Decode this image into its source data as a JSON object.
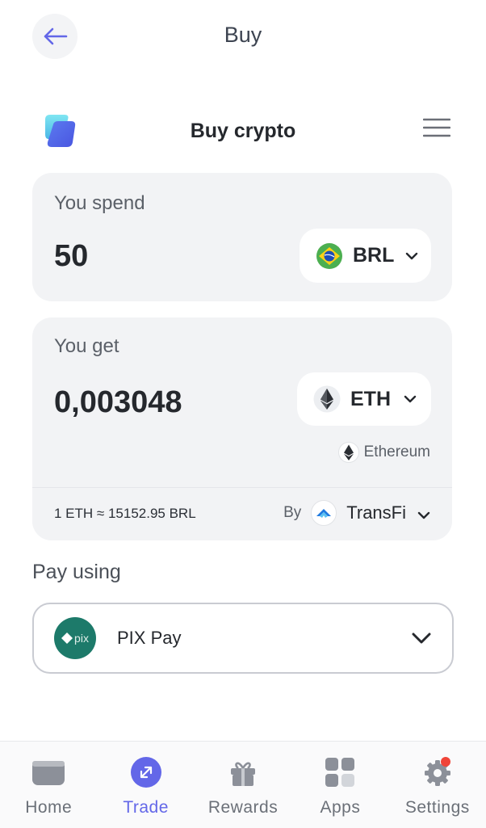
{
  "header": {
    "title": "Buy"
  },
  "widget": {
    "title": "Buy crypto"
  },
  "spend": {
    "label": "You spend",
    "amount": "50",
    "currency": "BRL"
  },
  "get": {
    "label": "You get",
    "amount": "0,003048",
    "currency": "ETH",
    "network": "Ethereum",
    "rate": "1 ETH ≈ 15152.95 BRL",
    "by_label": "By",
    "provider": "TransFi"
  },
  "pay": {
    "label": "Pay using",
    "method": "PIX Pay",
    "method_logo_text": "pix"
  },
  "nav": {
    "items": [
      {
        "label": "Home",
        "icon": "home-card-icon"
      },
      {
        "label": "Trade",
        "icon": "trade-icon",
        "active": true
      },
      {
        "label": "Rewards",
        "icon": "gift-icon"
      },
      {
        "label": "Apps",
        "icon": "apps-grid-icon"
      },
      {
        "label": "Settings",
        "icon": "gear-icon"
      }
    ]
  },
  "colors": {
    "accent": "#6367e8",
    "card_bg": "#f2f3f5",
    "pix_green": "#1d7a6a",
    "notification_dot": "#f04438"
  }
}
